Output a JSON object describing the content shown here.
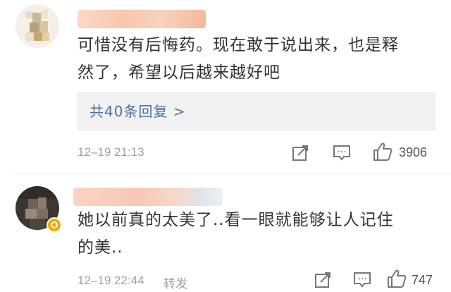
{
  "comments": [
    {
      "text_line1": "可惜没有后悔药。现在敢于说出来，也是释",
      "text_line2": "然了，希望以后越来越好吧",
      "replies_label": "共40条回复 >",
      "timestamp": "12–19 21:13",
      "like_count": "3906"
    },
    {
      "text_line1": "她以前真的太美了..看一眼就能够让人记住",
      "text_line2": "的美..",
      "timestamp": "12–19 22:44",
      "forward_label": "转发",
      "like_count": "747"
    }
  ],
  "icons": {
    "share": "share-icon",
    "comment": "comment-icon",
    "like": "like-icon",
    "verified": "verified-badge-icon"
  },
  "colors": {
    "link": "#4a6fa5",
    "meta": "#a0a0a0",
    "replies_bg": "#f2f2f2",
    "verified": "#f2a900"
  }
}
